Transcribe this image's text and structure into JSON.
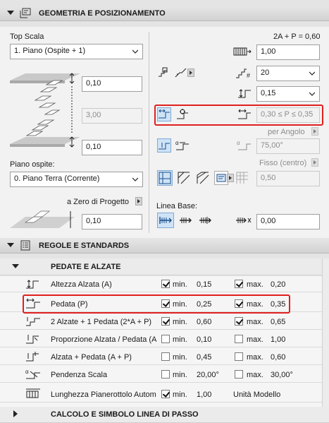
{
  "geometry": {
    "title": "GEOMETRIA E POSIZIONAMENTO",
    "top_scala_label": "Top Scala",
    "top_scala_value": "1. Piano (Ospite + 1)",
    "top_offset": "0,10",
    "height_value": "3,00",
    "bottom_offset": "0,10",
    "piano_ospite_label": "Piano ospite:",
    "piano_ospite_value": "0. Piano Terra (Corrente)",
    "zero_label": "a Zero di Progetto",
    "zero_value": "0,10",
    "formula": "2A + P = 0,60",
    "flight_width": "1,00",
    "risers_count": "20",
    "riser_height": "0,15",
    "tread_range": "0,30 ≤ P ≤ 0,35",
    "per_angolo_label": "per Angolo",
    "angle_value": "75,00°",
    "fisso_label": "Fisso (centro)",
    "fisso_value": "0,50",
    "linea_base_label": "Linea Base:",
    "linea_base_value": "0,00"
  },
  "rules": {
    "title": "REGOLE E STANDARDS",
    "subsection_title": "PEDATE E ALZATE",
    "rows": [
      {
        "name": "Altezza Alzata (A)",
        "min_checked": true,
        "min_label": "min.",
        "min_value": "0,15",
        "max_checked": true,
        "max_label": "max.",
        "max_value": "0,20"
      },
      {
        "name": "Pedata (P)",
        "min_checked": true,
        "min_label": "min.",
        "min_value": "0,25",
        "max_checked": true,
        "max_label": "max.",
        "max_value": "0,35"
      },
      {
        "name": "2 Alzate + 1 Pedata (2*A + P)",
        "min_checked": true,
        "min_label": "min.",
        "min_value": "0,60",
        "max_checked": true,
        "max_label": "max.",
        "max_value": "0,65"
      },
      {
        "name": "Proporzione Alzata / Pedata (A / P)",
        "min_checked": false,
        "min_label": "min.",
        "min_value": "0,10",
        "max_checked": false,
        "max_label": "max.",
        "max_value": "1,00"
      },
      {
        "name": "Alzata + Pedata (A + P)",
        "min_checked": false,
        "min_label": "min.",
        "min_value": "0,45",
        "max_checked": false,
        "max_label": "max.",
        "max_value": "0,60"
      },
      {
        "name": "Pendenza Scala",
        "min_checked": false,
        "min_label": "min.",
        "min_value": "20,00°",
        "max_checked": false,
        "max_label": "max.",
        "max_value": "30,00°"
      },
      {
        "name": "Lunghezza Pianerottolo Automatico",
        "min_checked": true,
        "min_label": "min.",
        "min_value": "1,00",
        "max_checked": null,
        "max_label": "Unità Modello",
        "max_value": ""
      }
    ],
    "next_subsection_title": "CALCOLO E SIMBOLO LINEA DI PASSO"
  },
  "colors": {
    "highlight_red": "#e0201f",
    "active_blue": "#cfe3f7"
  }
}
